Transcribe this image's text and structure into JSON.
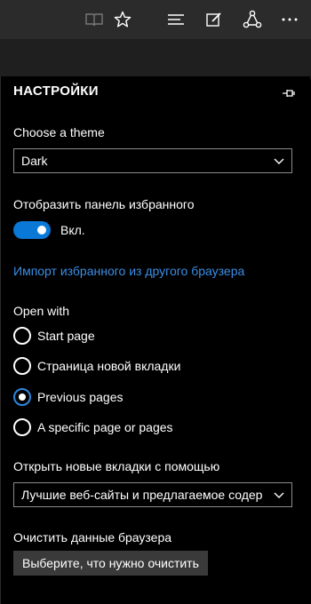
{
  "toolbar": {
    "icons": [
      "reading-view-icon",
      "favorites-star-icon",
      "hub-icon",
      "web-note-icon",
      "share-icon",
      "more-icon"
    ]
  },
  "settings": {
    "title": "НАСТРОЙКИ",
    "theme_label": "Choose a theme",
    "theme_value": "Dark",
    "favorites_bar_label": "Отобразить панель избранного",
    "favorites_bar_toggle": "Вкл.",
    "import_link": "Импорт избранного из другого браузера",
    "open_with_label": "Open with",
    "open_with_options": [
      {
        "label": "Start page",
        "selected": false
      },
      {
        "label": "Страница новой вкладки",
        "selected": false
      },
      {
        "label": "Previous pages",
        "selected": true
      },
      {
        "label": "A specific page or pages",
        "selected": false
      }
    ],
    "new_tabs_label": "Открыть новые вкладки с помощью",
    "new_tabs_value": "Лучшие веб-сайты и предлагаемое содер",
    "clear_data_label": "Очистить данные браузера",
    "clear_data_button": "Выберите, что нужно очистить"
  },
  "colors": {
    "accent": "#0a78d6",
    "link": "#3b8ee6",
    "background": "#000000",
    "toolbar": "#2b2b2b"
  }
}
